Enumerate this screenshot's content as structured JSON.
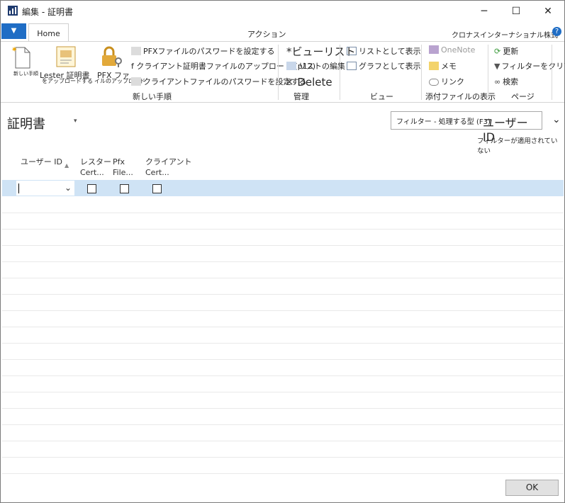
{
  "window": {
    "title": "編集 - 証明書",
    "controls": [
      "─",
      "☐",
      "✕"
    ]
  },
  "ribbon_tabs": {
    "app_menu": "▼",
    "home": "Home",
    "actions": "アクション",
    "company": "クロナスインターナショナル株式会社",
    "help": "?"
  },
  "ribbon": {
    "new_procedure_label": "新しい手順",
    "lester_label": "Lester 証明書",
    "lester_sub": "をアップロードする",
    "pfx_label": "PFX ファ",
    "pfx_sub": "イルのアップロード",
    "cmd_set_pfx_password": "PFXファイルのパスワードを設定する",
    "cmd_upload_client_cert": "f クライアント証明書ファイルのアップロード (p12)",
    "cmd_set_client_password": "クライアントファイルのパスワードを設定する",
    "group_new_procedure": "新しい手順",
    "cmd_view_list": "*ビューリスト",
    "cmd_edit_list": "リストの編集",
    "cmd_delete": "Delete",
    "group_manage": "管理",
    "cmd_show_as_list": "リストとして表示",
    "cmd_show_as_chart": "グラフとして表示",
    "group_view": "ビュー",
    "cmd_onenote": "OneNote",
    "cmd_memo": "メモ",
    "cmd_link": "リンク",
    "group_attachments": "添付ファイルの表示",
    "cmd_refresh": "更新",
    "cmd_clear_filter": "フィルターをクリア",
    "cmd_find": "検索",
    "group_page": "ページ"
  },
  "page": {
    "title": "証明書",
    "filter_placeholder": "フィルター - 処理する型 (F3)",
    "filter_field": "ユーザー ID",
    "no_filter": "フィルターが適用されていない"
  },
  "grid": {
    "columns": [
      {
        "line1": "ユーザー ID",
        "line2": ""
      },
      {
        "line1": "レスター",
        "line2": "Cert..."
      },
      {
        "line1": "Pfx",
        "line2": "File..."
      },
      {
        "line1": "クライアント",
        "line2": "Cert..."
      }
    ],
    "rows": [
      {
        "user_id": "",
        "lester_cert": false,
        "pfx_file": false,
        "client_cert": false
      }
    ]
  },
  "buttons": {
    "ok": "OK"
  },
  "colors": {
    "accent": "#1f6dc5",
    "selected_row": "#cfe3f5"
  }
}
